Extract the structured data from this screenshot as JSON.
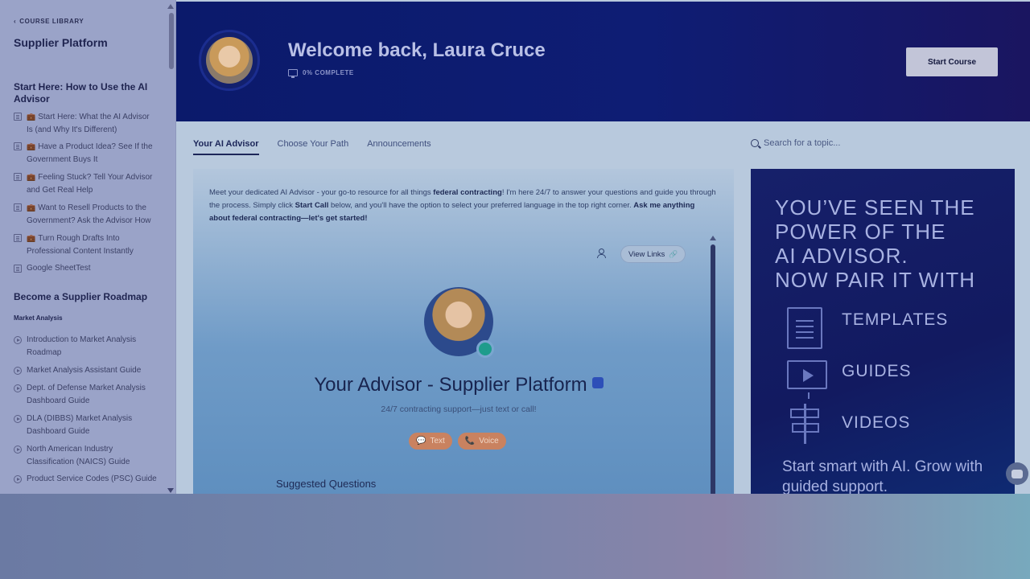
{
  "sidebar": {
    "back_label": "COURSE LIBRARY",
    "course_title": "Supplier Platform",
    "section1_title": "Start Here: How to Use the AI Advisor",
    "section1_items": [
      "Start Here: What the AI Advisor Is (and Why It's Different)",
      "Have a Product Idea? See If the Government Buys It",
      "Feeling Stuck? Tell Your Advisor and Get Real Help",
      "Want to Resell Products to the Government? Ask the Advisor How",
      "Turn Rough Drafts Into Professional Content Instantly",
      "Google SheetTest"
    ],
    "section2_title": "Become a Supplier Roadmap",
    "subsection_title": "Market Analysis",
    "section2_items": [
      "Introduction to Market Analysis Roadmap",
      "Market Analysis Assistant Guide",
      "Dept. of Defense Market Analysis Dashboard Guide",
      "DLA (DIBBS) Market Analysis Dashboard Guide",
      "North American Industry Classification (NAICS) Guide",
      "Product Service Codes (PSC) Guide"
    ]
  },
  "header": {
    "welcome": "Welcome back, Laura Cruce",
    "progress": "0% COMPLETE",
    "start_button": "Start Course"
  },
  "tabs": [
    "Your AI Advisor",
    "Choose Your Path",
    "Announcements"
  ],
  "search": {
    "placeholder": "Search for a topic..."
  },
  "advisor": {
    "intro_1": "Meet your dedicated AI Advisor - your go-to resource for all things ",
    "intro_bold_1": "federal contracting",
    "intro_2": "! I'm here 24/7 to answer your questions and guide you through the process. Simply click ",
    "intro_bold_2": "Start Call",
    "intro_3": " below, and you'll have the option to select your preferred language in the top right corner. ",
    "intro_bold_3": "Ask me anything about federal contracting—let's get started!",
    "view_links": "View Links",
    "title": "Your Advisor - Supplier Platform",
    "subtitle": "24/7 contracting support—just text or call!",
    "text_button": "Text",
    "voice_button": "Voice",
    "suggested": "Suggested Questions"
  },
  "promo": {
    "headline": [
      "YOU’VE SEEN THE",
      "POWER OF THE",
      "AI ADVISOR.",
      "NOW PAIR IT WITH"
    ],
    "templates": "TEMPLATES",
    "guides": "GUIDES",
    "videos": "VIDEOS",
    "footer": "Start smart with AI. Grow with guided support."
  },
  "colors": {
    "header_bg": "#0b1a6b",
    "promo_bg": "#16206a",
    "accent_button": "#c98260"
  }
}
